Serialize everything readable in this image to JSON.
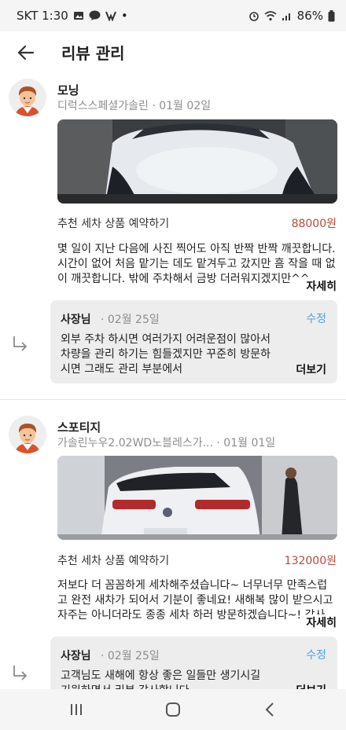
{
  "status": {
    "carrier_time": "SKT 1:30",
    "dot": "•",
    "battery": "86%"
  },
  "header": {
    "title": "리뷰 관리"
  },
  "reviews": [
    {
      "user": "모닝",
      "product_name": "디럭스스페셜가솔린",
      "date": "· 01월 02일",
      "package": "추천 세차 상품 예약하기",
      "price": "88000원",
      "content": "몇 일이 지난 다음에 사진 찍어도 아직 반짝 반짝 깨끗합니다. 시간이 없어 처음 맡기는 데도 맡겨두고 갔지만 흠 작을 때 없이 깨끗합니다. 밖에 주차해서 금방 더러워지겠지만^^",
      "more": "자세히",
      "reply": {
        "owner": "사장님",
        "date": "· 02월 25일",
        "edit": "수정",
        "text": "외부 주차 하시면 여러가지 어려운점이 많아서 차량을 관리 하기는 힘들겠지만 꾸준히 방문하시면 그래도 관리 부분에서",
        "more": "더보기"
      }
    },
    {
      "user": "스포티지",
      "product_name": "가솔린누우2.02WD노블레스가...",
      "date": "· 01월 01일",
      "package": "추천 세차 상품 예약하기",
      "price": "132000원",
      "content": "저보다 더 꼼꼼하게 세차해주셨습니다~ 너무너무 만족스럽고 완전 새차가 되어서 기분이 좋네요! 새해복 많이 받으시고 자주는 아니더라도 종종 세차 하러 방문하겠습니다~! 감사",
      "more": "자세히",
      "reply": {
        "owner": "사장님",
        "date": "· 02월 25일",
        "edit": "수정",
        "text": "고객님도 새해에  항상 좋은 일들만 생기시길 기원하면서 리뷰 감사합니다",
        "more": "더보기"
      }
    }
  ]
}
